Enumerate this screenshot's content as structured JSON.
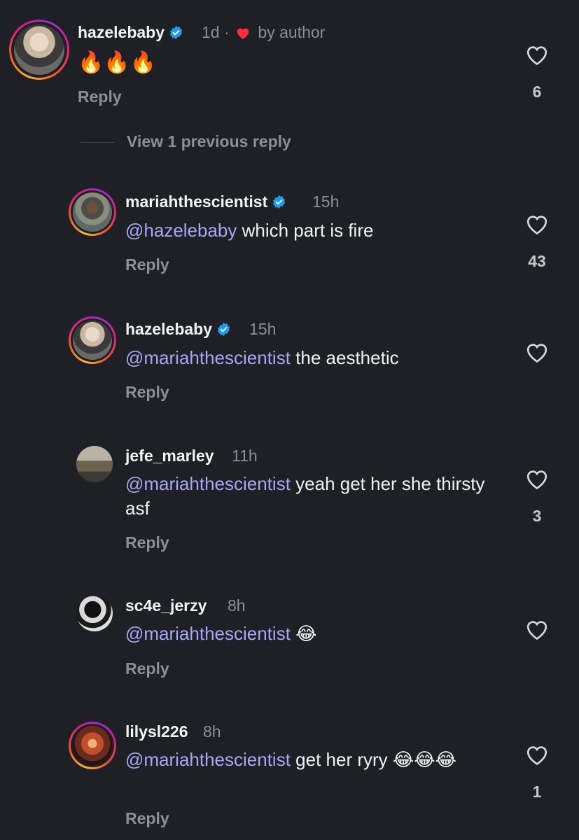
{
  "view_previous": "View 1 previous reply",
  "comments": [
    {
      "username": "hazelebaby",
      "verified": true,
      "time": "1d ·",
      "author_like": "by author",
      "text": "🔥🔥🔥",
      "reply": "Reply",
      "likes": "6",
      "avatar": "blonde-avatar"
    },
    {
      "username": "mariahthescientist",
      "verified": true,
      "time": "15h",
      "mention": "@hazelebaby",
      "text": " which part is fire",
      "reply": "Reply",
      "likes": "43",
      "avatar": "mariah-avatar"
    },
    {
      "username": "hazelebaby",
      "verified": true,
      "time": "15h",
      "mention": "@mariahthescientist",
      "text": " the aesthetic",
      "reply": "Reply",
      "likes": "",
      "avatar": "blonde-avatar"
    },
    {
      "username": "jefe_marley",
      "verified": false,
      "time": "11h",
      "mention": "@mariahthescientist",
      "text": " yeah get her she thirsty asf",
      "reply": "Reply",
      "likes": "3",
      "avatar": "jefe-avatar"
    },
    {
      "username": "sc4e_jerzy",
      "verified": false,
      "time": "8h",
      "mention": "@mariahthescientist",
      "text": " 😂",
      "reply": "Reply",
      "likes": "",
      "avatar": "jerzy-avatar"
    },
    {
      "username": "lilysl226",
      "verified": false,
      "time": "8h",
      "mention": "@mariahthescientist",
      "text": " get her ryry 😂😂😂",
      "reply": "Reply",
      "likes": "1",
      "avatar": "lily-avatar"
    }
  ],
  "colors": {
    "background": "#1f2025",
    "mention": "#a4a8f5",
    "muted": "#8e8f96",
    "verified": "#1d9bf0",
    "heart": "#ff2d3f"
  }
}
